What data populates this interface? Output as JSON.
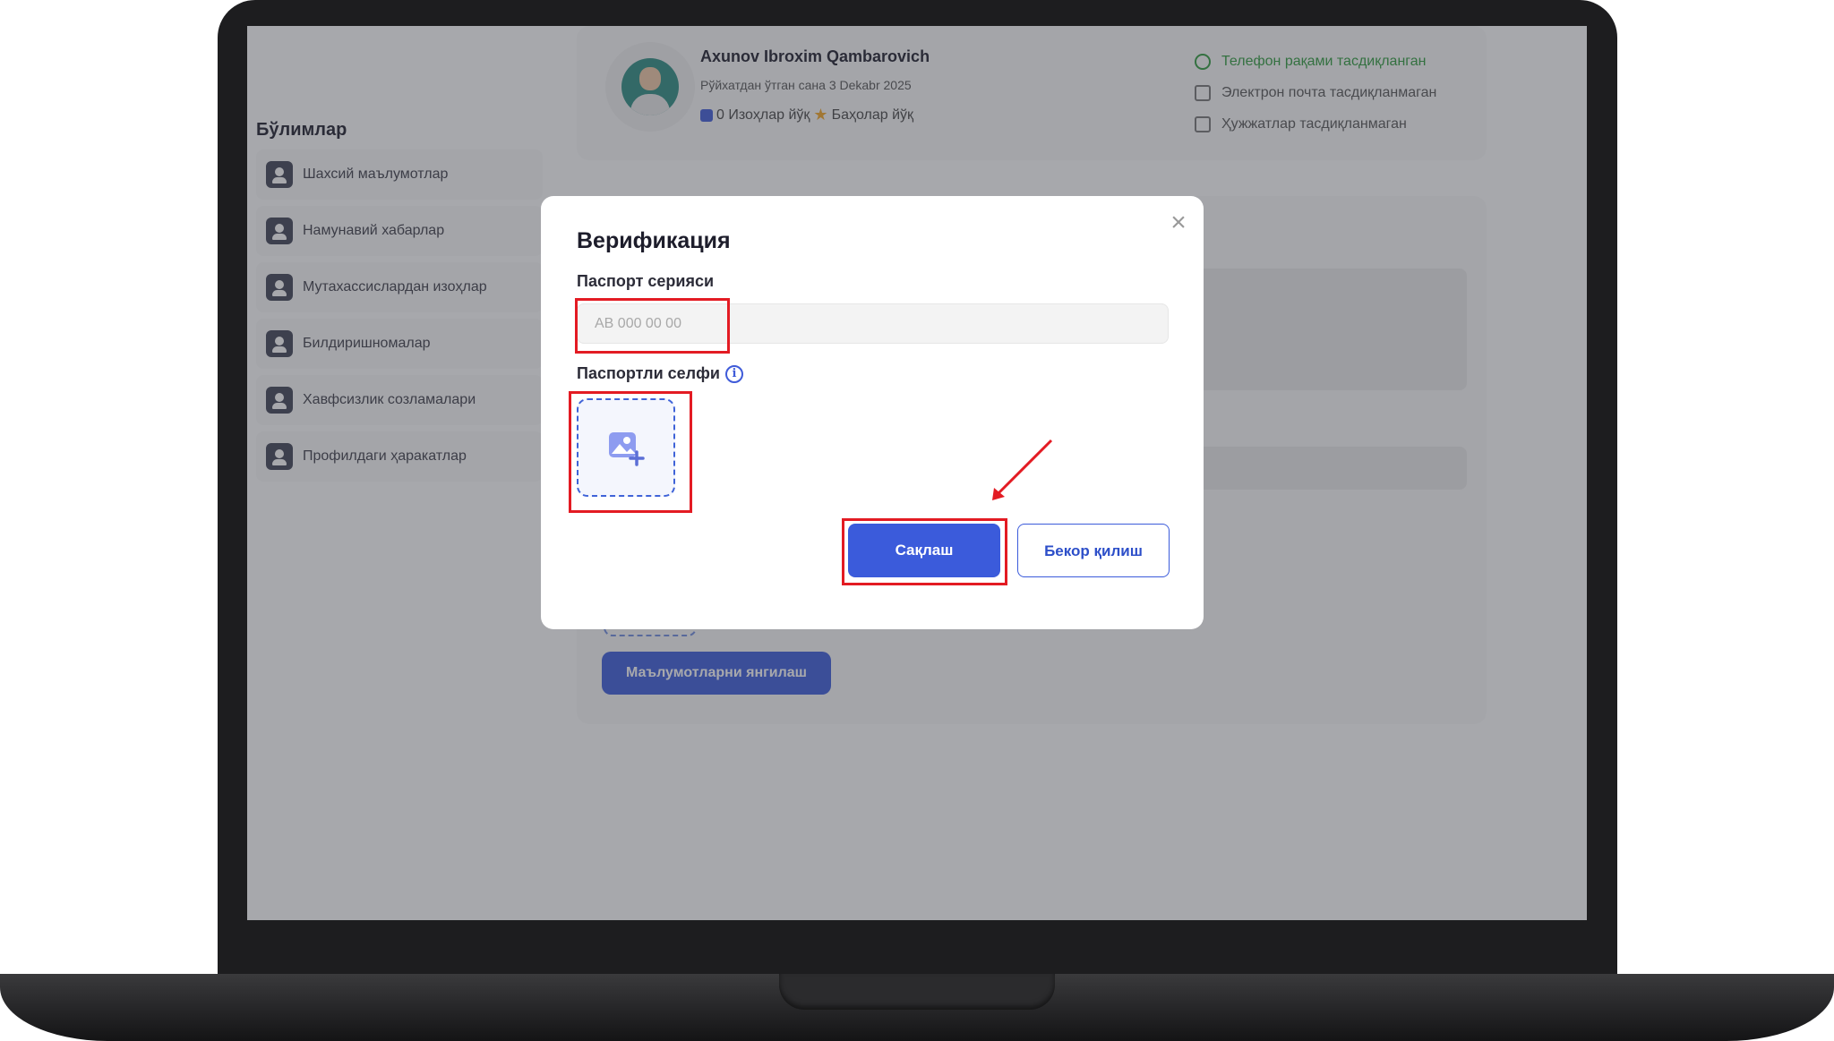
{
  "sidebar": {
    "title": "Бўлимлар",
    "items": [
      {
        "label": "Шахсий маълумотлар",
        "icon": "user-icon"
      },
      {
        "label": "Намунавий хабарлар",
        "icon": "message-card-icon"
      },
      {
        "label": "Мутахассислардан изоҳлар",
        "icon": "user-star-icon"
      },
      {
        "label": "Билдиришномалар",
        "icon": "bell-icon"
      },
      {
        "label": "Хавфсизлик созламалари",
        "icon": "user-shield-icon"
      },
      {
        "label": "Профилдаги ҳаракатлар",
        "icon": "user-gear-icon"
      }
    ]
  },
  "profile": {
    "name": "Axunov Ibroxim Qambarovich",
    "registered": "Рўйхатдан ўтган сана 3 Dekabr 2025",
    "comments": "0 Изоҳлар йўқ",
    "ratings": "Баҳолар йўқ"
  },
  "verification_status": [
    {
      "label": "Телефон рақами тасдиқланган",
      "verified": true,
      "icon": "phone-icon"
    },
    {
      "label": "Электрон почта тасдиқланмаган",
      "verified": false,
      "icon": "mail-icon"
    },
    {
      "label": "Ҳужжатлар тасдиқланмаган",
      "verified": false,
      "icon": "document-icon"
    }
  ],
  "main": {
    "update_button": "Маълумотларни янгилаш"
  },
  "modal": {
    "title": "Верификация",
    "passport_label": "Паспорт серияси",
    "passport_placeholder": "AB 000 00 00",
    "passport_value": "",
    "selfie_label": "Паспортли селфи",
    "info_glyph": "i",
    "close_glyph": "×",
    "save_label": "Сақлаш",
    "cancel_label": "Бекор қилиш"
  },
  "colors": {
    "accent": "#3b5bdb",
    "verified": "#2e9b3c",
    "annotation": "#e31b23",
    "overlay": "#3c3e48"
  }
}
